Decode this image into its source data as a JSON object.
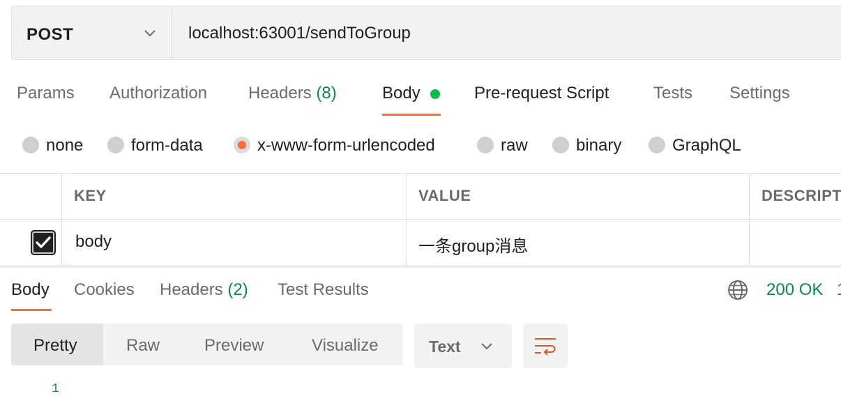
{
  "request": {
    "method": "POST",
    "url": "localhost:63001/sendToGroup"
  },
  "request_tabs": [
    {
      "label": "Params"
    },
    {
      "label": "Authorization"
    },
    {
      "label": "Headers",
      "count": "(8)"
    },
    {
      "label": "Body",
      "active": true
    },
    {
      "label": "Pre-request Script"
    },
    {
      "label": "Tests"
    },
    {
      "label": "Settings"
    }
  ],
  "body_types": [
    "none",
    "form-data",
    "x-www-form-urlencoded",
    "raw",
    "binary",
    "GraphQL"
  ],
  "body_type_selected": "x-www-form-urlencoded",
  "params_table": {
    "headers": [
      "KEY",
      "VALUE",
      "DESCRIPT"
    ],
    "rows": [
      {
        "checked": true,
        "key": "body",
        "value": "一条group消息",
        "description": ""
      }
    ]
  },
  "response": {
    "tabs": [
      {
        "label": "Body",
        "active": true
      },
      {
        "label": "Cookies"
      },
      {
        "label": "Headers",
        "count": "(2)"
      },
      {
        "label": "Test Results"
      }
    ],
    "status": "200 OK",
    "status_extra": "1",
    "view_modes": [
      "Pretty",
      "Raw",
      "Preview",
      "Visualize"
    ],
    "view_mode_selected": "Pretty",
    "format": "Text",
    "line_number": "1"
  },
  "colors": {
    "accent": "#ff6c37",
    "success": "#0c8a44",
    "dot": "#0cbb52"
  },
  "icons": [
    "chevron-down-icon",
    "globe-icon",
    "wrap-lines-icon",
    "checkmark-icon"
  ]
}
